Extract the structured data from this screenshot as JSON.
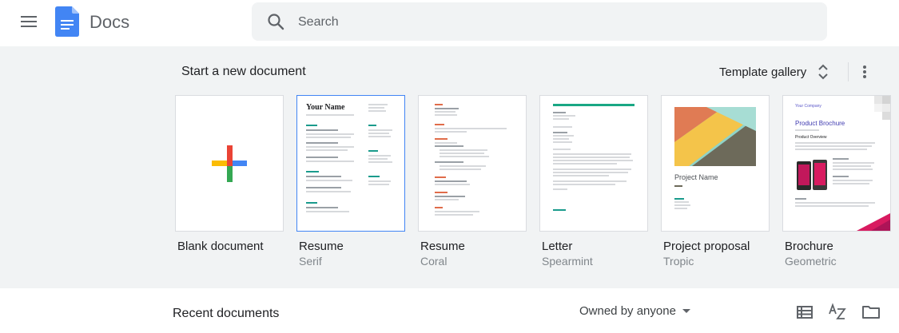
{
  "header": {
    "app_name": "Docs",
    "menu_icon": "hamburger-menu-icon",
    "logo_icon": "docs-logo-icon",
    "search": {
      "placeholder": "Search",
      "icon": "search-icon"
    }
  },
  "templates": {
    "section_title": "Start a new document",
    "gallery_label": "Template gallery",
    "more_icon": "more-vert-icon",
    "items": [
      {
        "title": "Blank document",
        "subtitle": ""
      },
      {
        "title": "Resume",
        "subtitle": "Serif",
        "preview_name": "Your Name"
      },
      {
        "title": "Resume",
        "subtitle": "Coral"
      },
      {
        "title": "Letter",
        "subtitle": "Spearmint"
      },
      {
        "title": "Project proposal",
        "subtitle": "Tropic",
        "preview_heading": "Project Name"
      },
      {
        "title": "Brochure",
        "subtitle": "Geometric",
        "preview_company": "Your Company",
        "preview_heading": "Product Brochure",
        "preview_section": "Product Overview"
      }
    ]
  },
  "recent": {
    "title": "Recent documents",
    "owner_filter": "Owned by anyone",
    "tools": [
      "list-view-icon",
      "sort-az-icon",
      "folder-icon"
    ]
  },
  "colors": {
    "accent_blue": "#4285f4",
    "plus_red": "#ea4335",
    "plus_yellow": "#fbbc04",
    "plus_green": "#34a853",
    "template_band": "#f1f3f4"
  }
}
